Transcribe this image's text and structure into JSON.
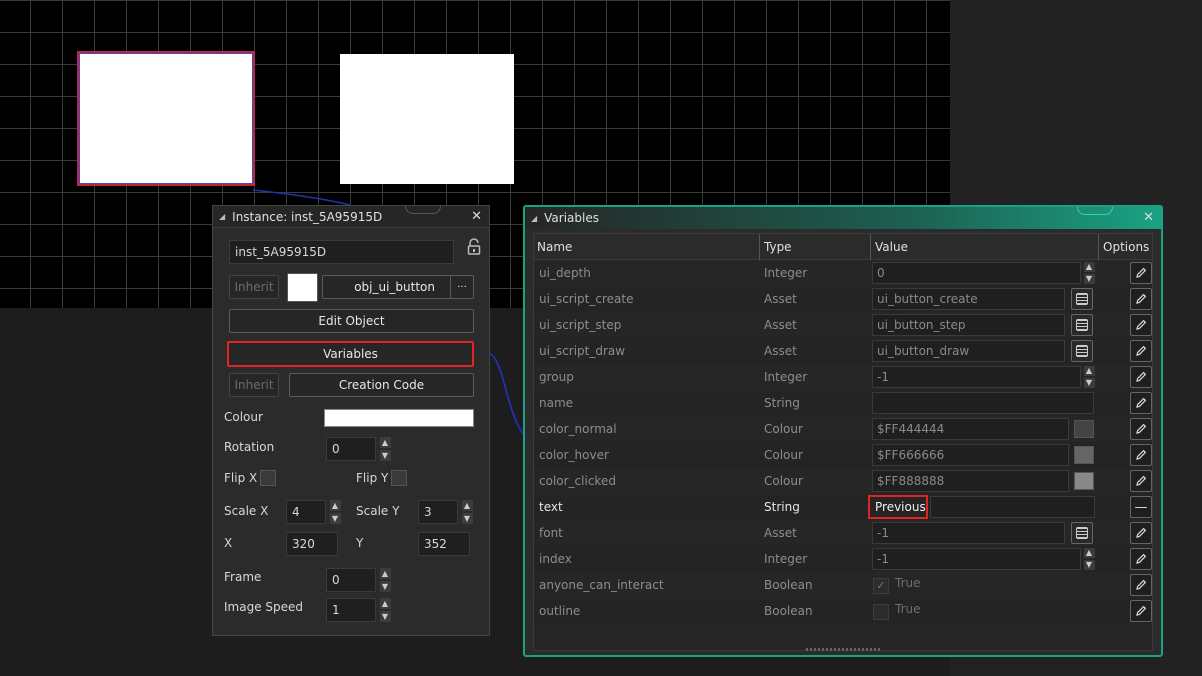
{
  "instance_panel": {
    "title": "Instance: inst_5A95915D",
    "name_value": "inst_5A95915D",
    "inherit_label": "Inherit",
    "object_name": "obj_ui_button",
    "more_label": "···",
    "edit_object_label": "Edit Object",
    "variables_label": "Variables",
    "inherit_label_2": "Inherit",
    "creation_code_label": "Creation Code",
    "colour_label": "Colour",
    "colour_value": "#FFFFFF",
    "rotation_label": "Rotation",
    "rotation_value": "0",
    "flip_x_label": "Flip X",
    "flip_y_label": "Flip Y",
    "scale_x_label": "Scale X",
    "scale_x_value": "4",
    "scale_y_label": "Scale Y",
    "scale_y_value": "3",
    "x_label": "X",
    "x_value": "320",
    "y_label": "Y",
    "y_value": "352",
    "frame_label": "Frame",
    "frame_value": "0",
    "image_speed_label": "Image Speed",
    "image_speed_value": "1"
  },
  "variables_panel": {
    "title": "Variables",
    "headers": {
      "name": "Name",
      "type": "Type",
      "value": "Value",
      "options": "Options"
    },
    "rows": [
      {
        "name": "ui_depth",
        "type": "Integer",
        "value": "0",
        "kind": "int"
      },
      {
        "name": "ui_script_create",
        "type": "Asset",
        "value": "ui_button_create",
        "kind": "asset"
      },
      {
        "name": "ui_script_step",
        "type": "Asset",
        "value": "ui_button_step",
        "kind": "asset"
      },
      {
        "name": "ui_script_draw",
        "type": "Asset",
        "value": "ui_button_draw",
        "kind": "asset"
      },
      {
        "name": "group",
        "type": "Integer",
        "value": "-1",
        "kind": "int"
      },
      {
        "name": "name",
        "type": "String",
        "value": "",
        "kind": "string"
      },
      {
        "name": "color_normal",
        "type": "Colour",
        "value": "$FF444444",
        "kind": "colour",
        "swatch": "#444444"
      },
      {
        "name": "color_hover",
        "type": "Colour",
        "value": "$FF666666",
        "kind": "colour",
        "swatch": "#666666"
      },
      {
        "name": "color_clicked",
        "type": "Colour",
        "value": "$FF888888",
        "kind": "colour",
        "swatch": "#888888"
      },
      {
        "name": "text",
        "type": "String",
        "value": "Previous",
        "kind": "active"
      },
      {
        "name": "font",
        "type": "Asset",
        "value": "-1",
        "kind": "asset"
      },
      {
        "name": "index",
        "type": "Integer",
        "value": "-1",
        "kind": "int"
      },
      {
        "name": "anyone_can_interact",
        "type": "Boolean",
        "value": "True",
        "kind": "bool",
        "checked": true
      },
      {
        "name": "outline",
        "type": "Boolean",
        "value": "True",
        "kind": "bool",
        "checked": false
      }
    ]
  },
  "colors": {
    "accent": "#1aa283",
    "highlight": "#e02525"
  }
}
